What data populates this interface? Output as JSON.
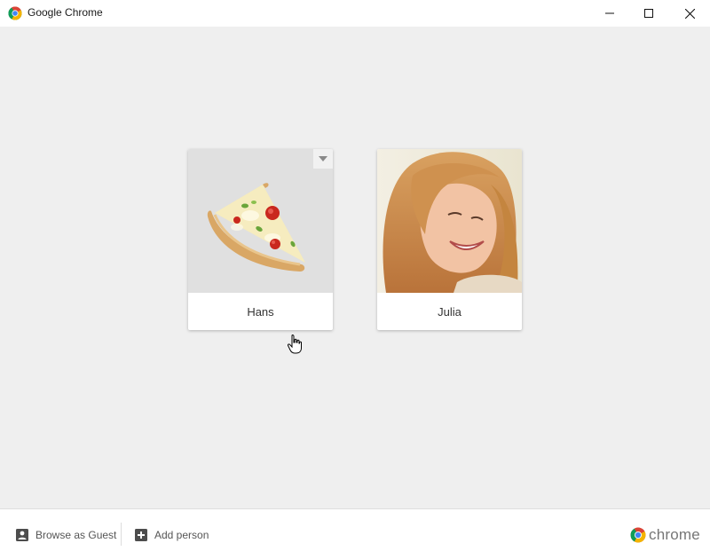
{
  "window": {
    "title": "Google Chrome",
    "icon": "chrome-logo-icon",
    "controls": [
      "minimize-icon",
      "maximize-icon",
      "close-icon"
    ]
  },
  "profiles": [
    {
      "name": "Hans",
      "avatar": "pizza-slice-avatar",
      "menu_icon": "chevron-down-icon"
    },
    {
      "name": "Julia",
      "avatar": "user-photo-avatar"
    }
  ],
  "footer": {
    "guest_label": "Browse as Guest",
    "guest_icon": "person-badge-icon",
    "add_label": "Add person",
    "add_icon": "plus-box-icon",
    "brand_text": "chrome",
    "brand_icon": "chrome-logo-icon"
  },
  "colors": {
    "background": "#efefef",
    "card": "#ffffff",
    "chrome_red": "#db4437",
    "chrome_yellow": "#f4b400",
    "chrome_green": "#0f9d58",
    "chrome_blue": "#4285f4"
  }
}
